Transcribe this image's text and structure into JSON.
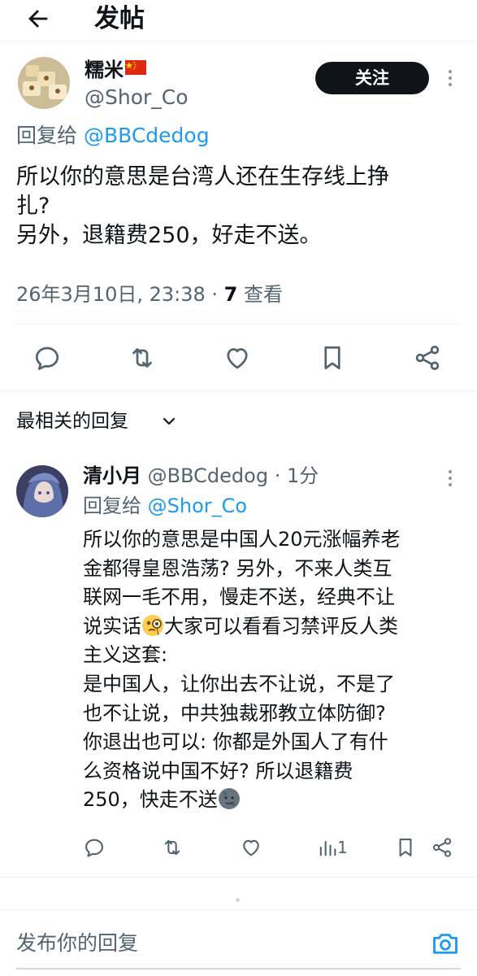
{
  "header": {
    "title": "发帖",
    "back_icon": "arrow-left-icon"
  },
  "post": {
    "author_name": "糯米",
    "author_flag": "china-flag",
    "author_handle": "@Shor_Co",
    "follow_label": "关注",
    "reply_prefix": "回复给",
    "reply_to": "@BBCdedog",
    "body_lines": [
      "所以你的意思是台湾人还在生存线上挣",
      "扎?",
      "另外，退籍费250，好走不送。"
    ],
    "timestamp": "26年3月10日, 23:38 · ",
    "views_count": "7",
    "views_label": " 查看"
  },
  "sort": {
    "label": "最相关的回复"
  },
  "reply": {
    "author_name": "清小月",
    "author_handle": "@BBCdedog",
    "time": " · 1分",
    "reply_prefix": "回复给",
    "reply_to": "@Shor_Co",
    "body_lines": [
      "所以你的意思是中国人20元涨幅养老",
      "金都得皇恩浩荡? 另外，不来人类互",
      "联网一毛不用，慢走不送，经典不让",
      "说实话",
      "大家可以看看习禁评反人类",
      "主义这套:",
      "是中国人，让你出去不让说，不是了",
      "也不让说，中共独裁邪教立体防御?",
      "你退出也可以: 你都是外国人了有什",
      "么资格说中国不好? 所以退籍费",
      "250，快走不送"
    ],
    "views_count": "1"
  },
  "composer": {
    "placeholder": "发布你的回复"
  },
  "colors": {
    "link": "#1d9bf0",
    "secondary": "#536471",
    "primary": "#0f1419"
  }
}
